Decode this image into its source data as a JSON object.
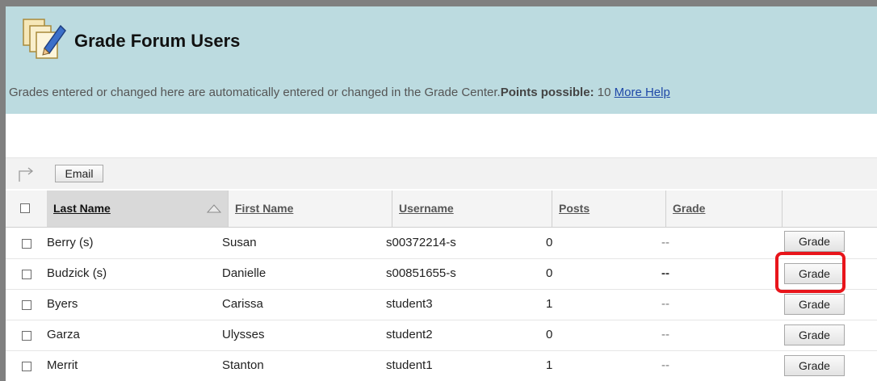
{
  "header": {
    "title": "Grade Forum Users",
    "instructions": "Grades entered or changed here are automatically entered or changed in the Grade Center.",
    "points_label": "Points possible:",
    "points_value": "10",
    "help_link": "More Help"
  },
  "toolbar": {
    "email_label": "Email"
  },
  "columns": [
    "Last Name",
    "First Name",
    "Username",
    "Posts",
    "Grade"
  ],
  "sort": {
    "column": "Last Name",
    "direction": "ascending"
  },
  "rows": [
    {
      "last": "Berry (s)",
      "first": "Susan",
      "username": "s00372214-s",
      "posts": "0",
      "grade": "--",
      "button": "Grade"
    },
    {
      "last": "Budzick (s)",
      "first": "Danielle",
      "username": "s00851655-s",
      "posts": "0",
      "grade": "--",
      "button": "Grade"
    },
    {
      "last": "Byers",
      "first": "Carissa",
      "username": "student3",
      "posts": "1",
      "grade": "--",
      "button": "Grade"
    },
    {
      "last": "Garza",
      "first": "Ulysses",
      "username": "student2",
      "posts": "0",
      "grade": "--",
      "button": "Grade"
    },
    {
      "last": "Merrit",
      "first": "Stanton",
      "username": "student1",
      "posts": "1",
      "grade": "--",
      "button": "Grade"
    }
  ],
  "colors": {
    "header_bg": "#bcdbe0",
    "link": "#1f48a8",
    "highlight": "#e8151b"
  },
  "icons": [
    "grade-forum-icon",
    "arrow-icon",
    "sort-ascending-icon"
  ]
}
